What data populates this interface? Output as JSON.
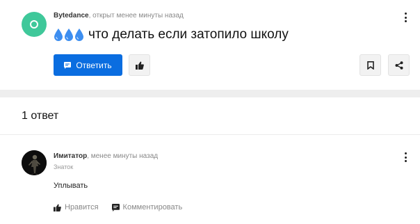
{
  "question": {
    "author": "Bytedance",
    "meta_suffix": ", открыт менее минуты назад",
    "title": "что делать если затопило школу",
    "answer_button_label": "Ответить"
  },
  "answers_section": {
    "count_label": "1 ответ",
    "answers": [
      {
        "author": "Имитатор",
        "time_suffix": ", менее минуты назад",
        "role": "Знаток",
        "text": "Уплывать",
        "like_label": "Нравится",
        "comment_label": "Комментировать"
      }
    ]
  },
  "colors": {
    "primary": "#0a6de0",
    "avatar_green": "#3fc89a",
    "drop_blue": "#3d8ef0"
  },
  "icons": [
    "dots-vertical-icon",
    "water-drop-icon",
    "comment-icon",
    "thumbs-up-icon",
    "bookmark-icon",
    "share-icon"
  ]
}
